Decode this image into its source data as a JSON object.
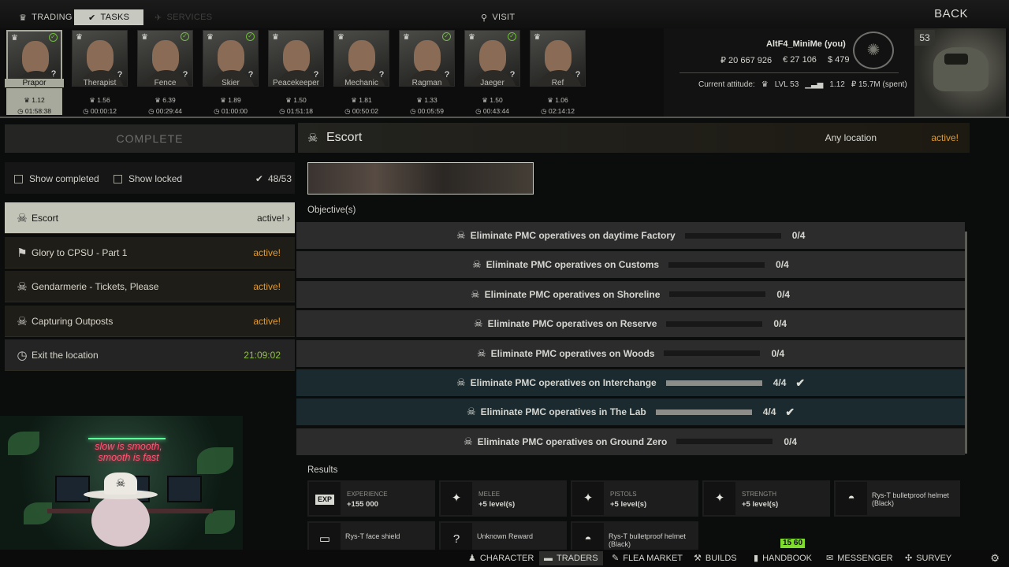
{
  "topnav": {
    "trading_label": "TRADING",
    "tasks_label": "TASKS",
    "services_label": "SERVICES",
    "visit_label": "VISIT",
    "back_label": "BACK"
  },
  "traders": [
    {
      "name": "Prapor",
      "rep": "1.12",
      "time": "01:58:38",
      "completed": true,
      "selected": true
    },
    {
      "name": "Therapist",
      "rep": "1.56",
      "time": "00:00:12",
      "completed": false
    },
    {
      "name": "Fence",
      "rep": "6.39",
      "time": "00:29:44",
      "completed": true
    },
    {
      "name": "Skier",
      "rep": "1.89",
      "time": "01:00:00",
      "completed": true
    },
    {
      "name": "Peacekeeper",
      "rep": "1.50",
      "time": "01:51:18",
      "completed": false
    },
    {
      "name": "Mechanic",
      "rep": "1.81",
      "time": "00:50:02",
      "completed": false
    },
    {
      "name": "Ragman",
      "rep": "1.33",
      "time": "00:05:59",
      "completed": true
    },
    {
      "name": "Jaeger",
      "rep": "1.50",
      "time": "00:43:44",
      "completed": true
    },
    {
      "name": "Ref",
      "rep": "1.06",
      "time": "02:14:12",
      "completed": false
    }
  ],
  "player": {
    "name": "AltF4_MiniMe (you)",
    "roubles": "₽ 20 667 926",
    "euros": "€ 27 106",
    "dollars": "$ 479",
    "attitude_label": "Current attitude:",
    "level": "LVL 53",
    "standing": "1.12",
    "spent": "₽ 15.7M (spent)",
    "level_badge": "53"
  },
  "left": {
    "complete_label": "COMPLETE",
    "show_completed": "Show completed",
    "show_locked": "Show locked",
    "count": "48/53"
  },
  "quests": [
    {
      "name": "Escort",
      "status": "active!",
      "icon": "skull-icon"
    },
    {
      "name": "Glory to CPSU - Part 1",
      "status": "active!",
      "icon": "run-icon"
    },
    {
      "name": "Gendarmerie - Tickets, Please",
      "status": "active!",
      "icon": "skull-icon"
    },
    {
      "name": "Capturing Outposts",
      "status": "active!",
      "icon": "skull-icon"
    },
    {
      "name": "Exit the location",
      "status": "21:09:02",
      "icon": "clock-icon"
    }
  ],
  "webcam": {
    "neon_line1": "slow is smooth,",
    "neon_line2": "smooth is fast"
  },
  "detail": {
    "title": "Escort",
    "location": "Any location",
    "status": "active!",
    "objectives_label": "Objective(s)",
    "results_label": "Results"
  },
  "objectives": [
    {
      "text": "Eliminate PMC operatives on daytime Factory",
      "progress": "0/4",
      "fraction": 0,
      "done": false
    },
    {
      "text": "Eliminate PMC operatives on Customs",
      "progress": "0/4",
      "fraction": 0,
      "done": false
    },
    {
      "text": "Eliminate PMC operatives on Shoreline",
      "progress": "0/4",
      "fraction": 0,
      "done": false
    },
    {
      "text": "Eliminate PMC operatives on Reserve",
      "progress": "0/4",
      "fraction": 0,
      "done": false
    },
    {
      "text": "Eliminate PMC operatives on Woods",
      "progress": "0/4",
      "fraction": 0,
      "done": false
    },
    {
      "text": "Eliminate PMC operatives on Interchange",
      "progress": "4/4",
      "fraction": 1,
      "done": true
    },
    {
      "text": "Eliminate PMC operatives in The Lab",
      "progress": "4/4",
      "fraction": 1,
      "done": true
    },
    {
      "text": "Eliminate PMC operatives on Ground Zero",
      "progress": "0/4",
      "fraction": 0,
      "done": false
    }
  ],
  "rewards": [
    {
      "icon": "EXP",
      "title": "EXPERIENCE",
      "value": "+155 000"
    },
    {
      "icon": "bulb-icon",
      "title": "MELEE",
      "value": "+5 level(s)"
    },
    {
      "icon": "bulb-icon",
      "title": "PISTOLS",
      "value": "+5 level(s)"
    },
    {
      "icon": "bulb-icon",
      "title": "STRENGTH",
      "value": "+5 level(s)"
    },
    {
      "icon": "helmet-icon",
      "text": "Rys-T bulletproof helmet (Black)"
    },
    {
      "icon": "face-shield-icon",
      "text": "Rys-T face shield"
    },
    {
      "icon": "question-icon",
      "text": "Unknown Reward"
    },
    {
      "icon": "helmet-icon",
      "text": "Rys-T bulletproof helmet (Black)"
    }
  ],
  "fps_badge": "15 60",
  "bottomnav": {
    "character": "CHARACTER",
    "traders": "TRADERS",
    "flea_market": "FLEA MARKET",
    "builds": "BUILDS",
    "handbook": "HANDBOOK",
    "messenger": "MESSENGER",
    "survey": "SURVEY"
  },
  "colors": {
    "active_orange": "#e39a2e",
    "timer_green": "#8fc43a",
    "check_green": "#6fbe3b",
    "selected_bg": "#c3c4b8"
  }
}
